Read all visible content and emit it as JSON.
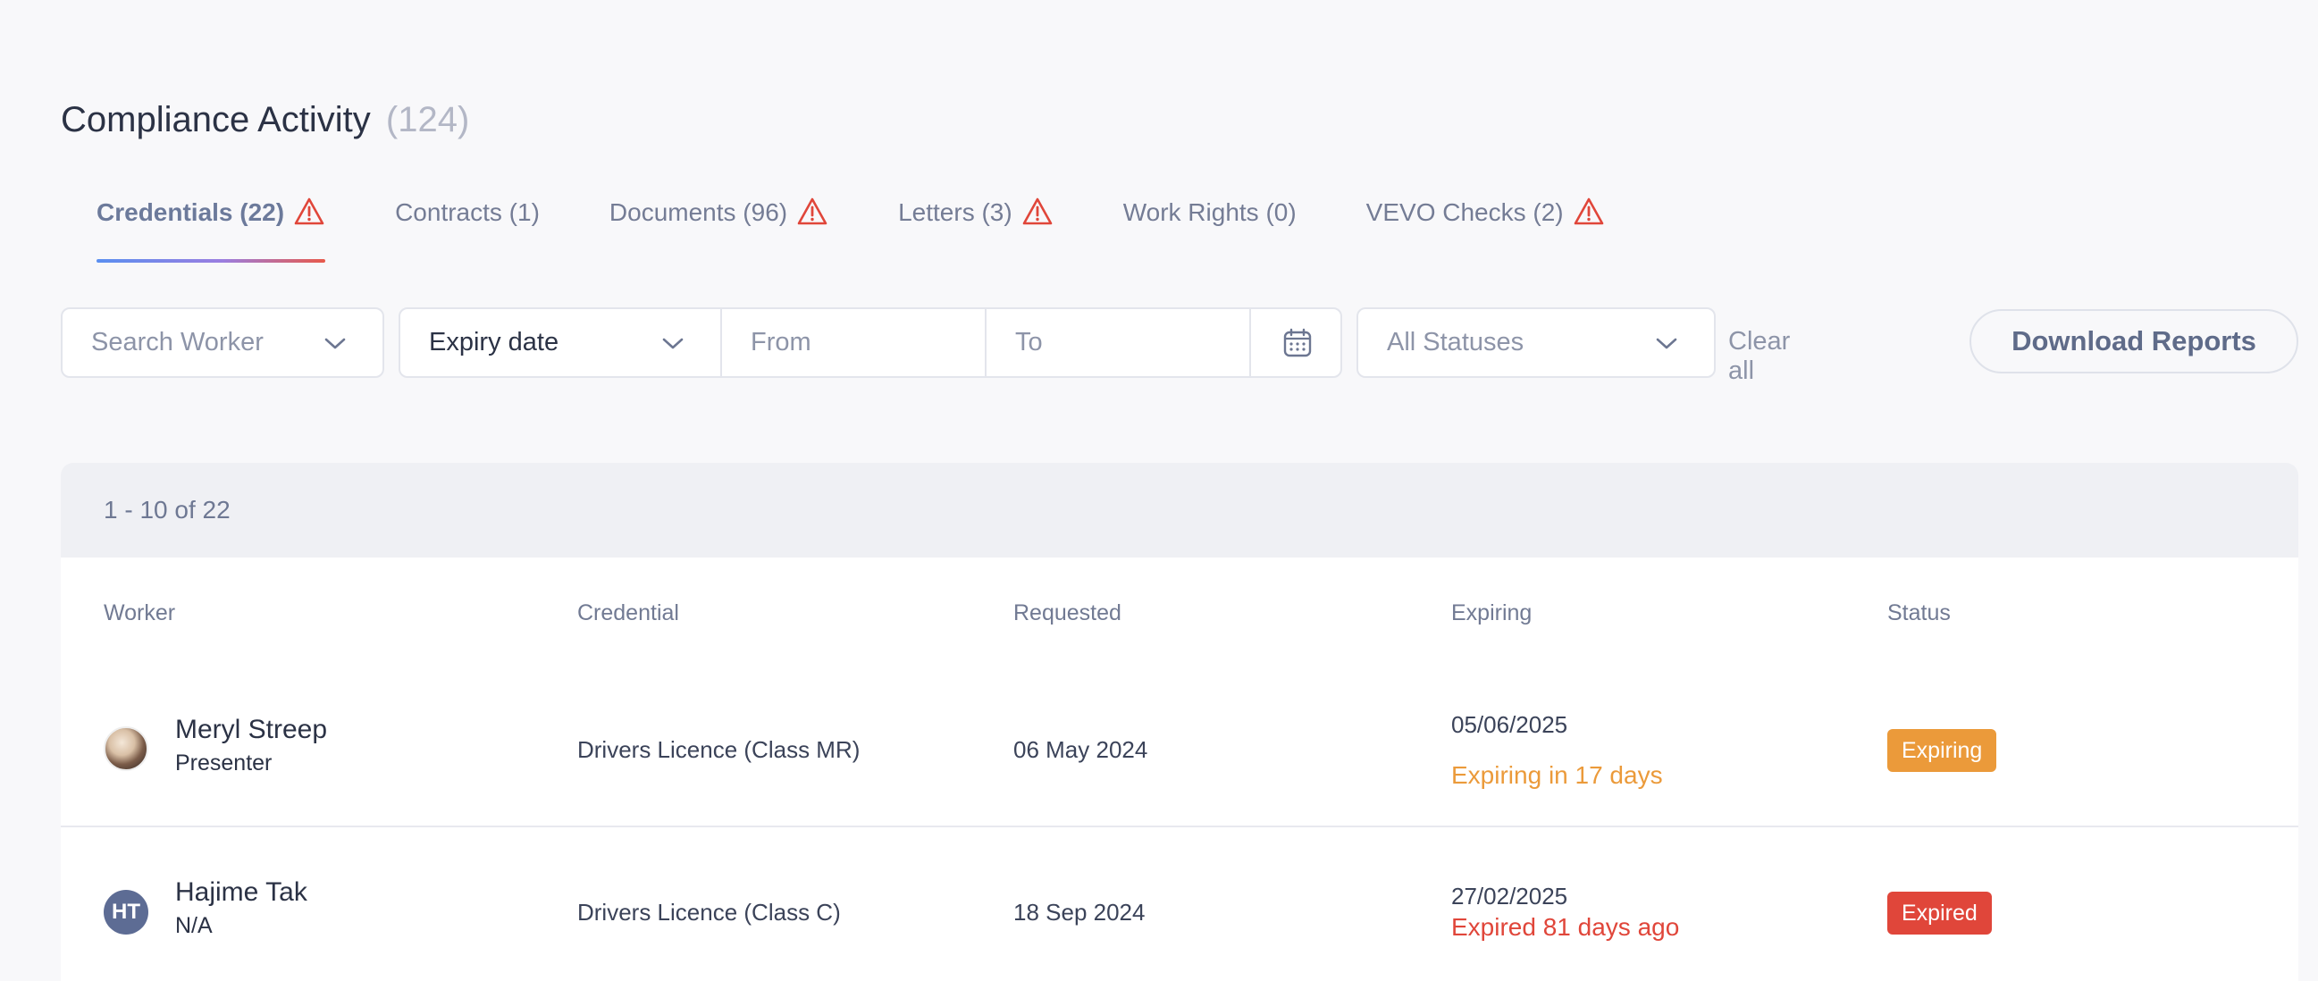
{
  "header": {
    "title": "Compliance Activity",
    "count": "(124)"
  },
  "tabs": [
    {
      "label": "Credentials (22)",
      "warning": true,
      "active": true
    },
    {
      "label": "Contracts (1)",
      "warning": false
    },
    {
      "label": "Documents (96)",
      "warning": true
    },
    {
      "label": "Letters (3)",
      "warning": true
    },
    {
      "label": "Work Rights (0)",
      "warning": false
    },
    {
      "label": "VEVO Checks (2)",
      "warning": true
    }
  ],
  "filters": {
    "search_worker": "Search Worker",
    "date_type": "Expiry date",
    "from": "From",
    "to": "To",
    "status": "All Statuses",
    "clear_all": "Clear all",
    "download": "Download Reports"
  },
  "table": {
    "pagination": "1 - 10 of 22",
    "columns": [
      "Worker",
      "Credential",
      "Requested",
      "Expiring",
      "Status"
    ],
    "rows": [
      {
        "worker_name": "Meryl Streep",
        "worker_role": "Presenter",
        "avatar": "photo",
        "credential": "Drivers Licence (Class MR)",
        "requested": "06 May 2024",
        "expiring_date": "05/06/2025",
        "expiring_note": "Expiring in 17 days",
        "status": "Expiring"
      },
      {
        "worker_name": "Hajime Tak",
        "worker_role": "N/A",
        "avatar": "HT",
        "credential": "Drivers Licence (Class C)",
        "requested": "18 Sep 2024",
        "expiring_date": "27/02/2025",
        "expiring_note": "Expired 81 days ago",
        "status": "Expired"
      }
    ]
  },
  "colors": {
    "warning_icon": "#e0463a",
    "expiring": "#eb9a3a",
    "expired": "#e0463a",
    "initials_avatar": "#5d6c94"
  }
}
